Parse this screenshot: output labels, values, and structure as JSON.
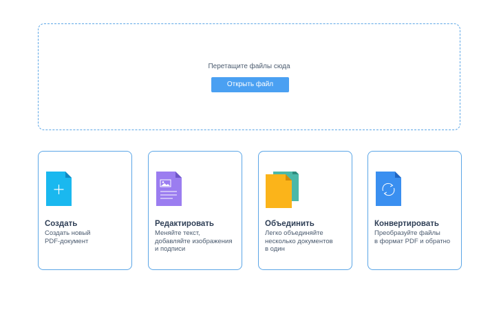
{
  "dropzone": {
    "hint": "Перетащите файлы сюда",
    "open_button": "Открыть файл"
  },
  "colors": {
    "accent": "#4aa0f2",
    "border": "#5aa5e6"
  },
  "cards": [
    {
      "title": "Создать",
      "desc": [
        "Создать новый",
        "PDF-документ"
      ],
      "icon": "new-document-icon",
      "color": "#1ab8ef"
    },
    {
      "title": "Редактировать",
      "desc": [
        "Меняйте текст,",
        "добавляйте изображения",
        "и подписи"
      ],
      "icon": "edit-document-icon",
      "color": "#9b7df0"
    },
    {
      "title": "Объединить",
      "desc": [
        "Легко объединяйте",
        "несколько документов",
        "в один"
      ],
      "icon": "merge-documents-icon",
      "color": "#fbb41a"
    },
    {
      "title": "Конвертировать",
      "desc": [
        "Преобразуйте файлы",
        "в формат PDF и обратно"
      ],
      "icon": "convert-document-icon",
      "color": "#3a8ff0"
    }
  ]
}
